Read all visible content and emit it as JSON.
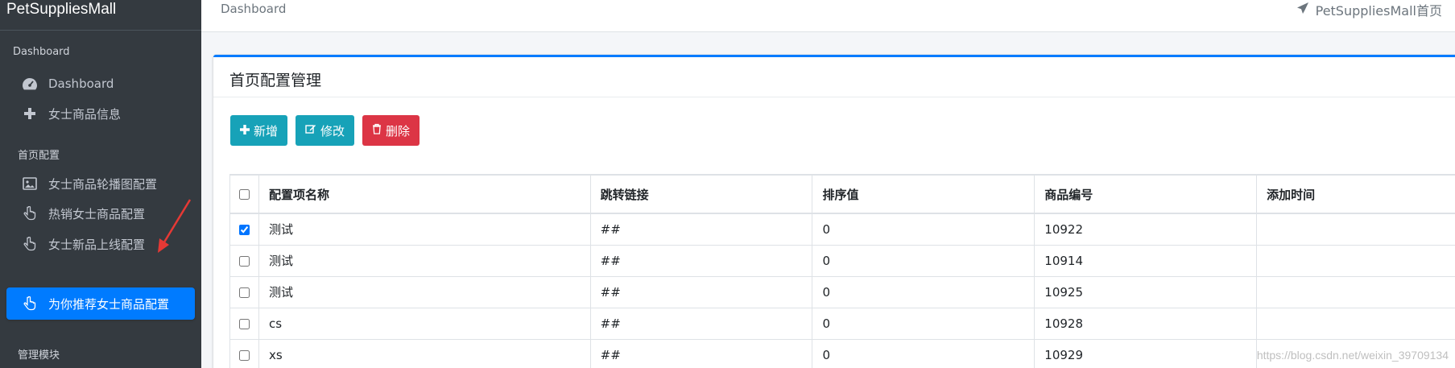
{
  "app": {
    "brand": "PetSuppliesMall"
  },
  "sidebar": {
    "sections": [
      {
        "header": "Dashboard",
        "items": [
          {
            "label": "Dashboard",
            "icon": "tachometer-icon"
          },
          {
            "label": "女士商品信息",
            "icon": "plus-icon"
          }
        ]
      },
      {
        "header": "首页配置",
        "items": [
          {
            "label": "女士商品轮播图配置",
            "icon": "image-icon"
          },
          {
            "label": "热销女士商品配置",
            "icon": "hand-pointer-icon"
          },
          {
            "label": "女士新品上线配置",
            "icon": "hand-pointer-icon"
          },
          {
            "label": "为你推荐女士商品配置",
            "icon": "hand-pointer-icon",
            "active": true
          }
        ]
      },
      {
        "header": "管理模块",
        "items": []
      }
    ]
  },
  "topbar": {
    "breadcrumb": "Dashboard",
    "home_link": "PetSuppliesMall首页"
  },
  "card": {
    "title": "首页配置管理",
    "buttons": {
      "add": "新增",
      "edit": "修改",
      "delete": "删除"
    }
  },
  "table": {
    "headers": [
      "配置项名称",
      "跳转链接",
      "排序值",
      "商品编号",
      "添加时间"
    ],
    "rows": [
      {
        "checked": true,
        "name": "测试",
        "link": "##",
        "sort": "0",
        "goods_id": "10922",
        "time": ""
      },
      {
        "checked": false,
        "name": "测试",
        "link": "##",
        "sort": "0",
        "goods_id": "10914",
        "time": ""
      },
      {
        "checked": false,
        "name": "测试",
        "link": "##",
        "sort": "0",
        "goods_id": "10925",
        "time": ""
      },
      {
        "checked": false,
        "name": "cs",
        "link": "##",
        "sort": "0",
        "goods_id": "10928",
        "time": ""
      },
      {
        "checked": false,
        "name": "xs",
        "link": "##",
        "sort": "0",
        "goods_id": "10929",
        "time": ""
      }
    ]
  },
  "watermark": "https://blog.csdn.net/weixin_39709134",
  "colors": {
    "sidebar": "#343a40",
    "primary": "#007bff",
    "info": "#17a2b8",
    "danger": "#dc3545"
  }
}
